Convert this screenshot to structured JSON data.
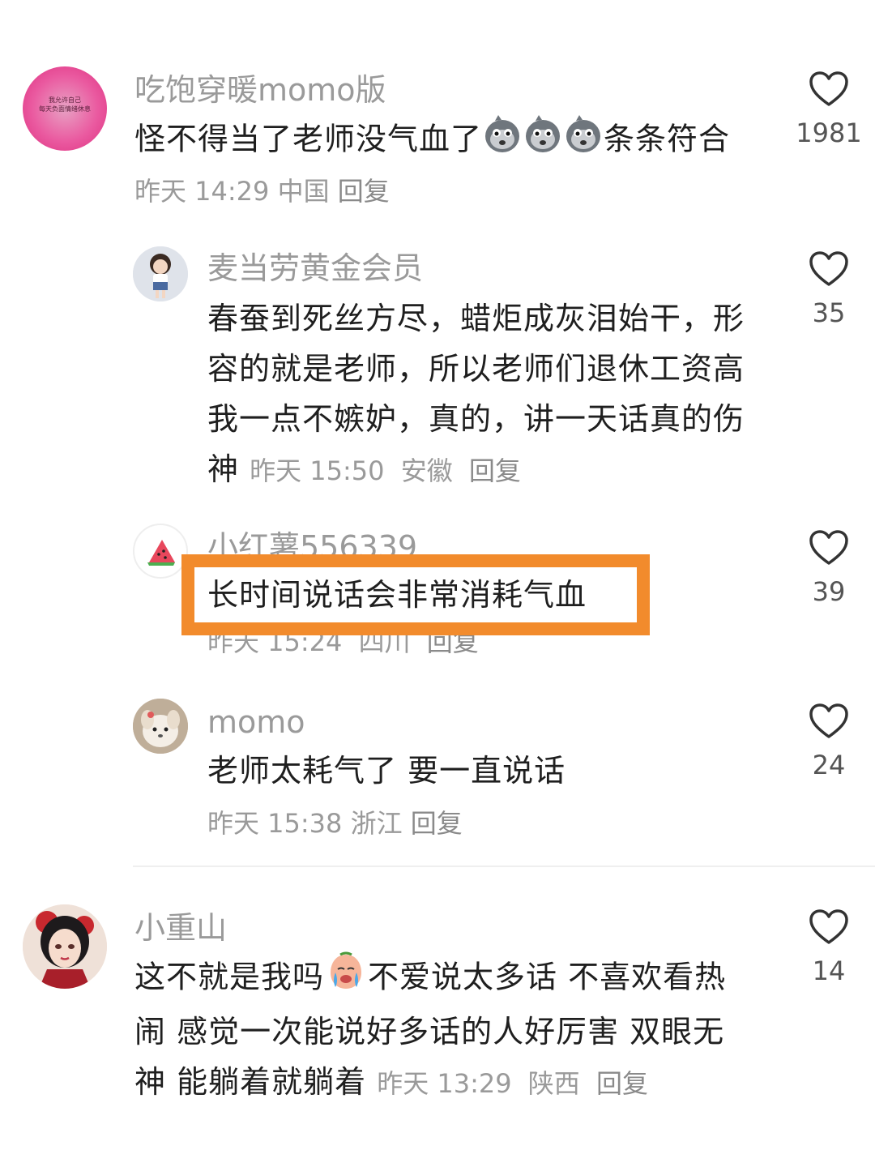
{
  "comments": [
    {
      "name": "吃饱穿暖momo版",
      "text_before": "怪不得当了老师没气血了",
      "text_after": "条条符合",
      "emojis": [
        "sad-face-emoji",
        "sad-face-emoji",
        "sad-face-emoji"
      ],
      "time": "昨天 14:29",
      "location": "中国",
      "reply": "回复",
      "likes": "1981",
      "avatar_text": "我允许自己\n每天负面情绪休息"
    },
    {
      "name": "麦当劳黄金会员",
      "text": "春蚕到死丝方尽，蜡炬成灰泪始干，形容的就是老师，所以老师们退休工资高我一点不嫉妒，真的，讲一天话真的伤神",
      "time": "昨天 15:50",
      "location": "安徽",
      "reply": "回复",
      "likes": "35"
    },
    {
      "name": "小红薯556339",
      "text": "长时间说话会非常消耗气血",
      "time": "昨天 15:24",
      "location": "四川",
      "reply": "回复",
      "likes": "39"
    },
    {
      "name": "momo",
      "text": "老师太耗气了 要一直说话",
      "time": "昨天 15:38",
      "location": "浙江",
      "reply": "回复",
      "likes": "24"
    },
    {
      "name": "小重山",
      "text_before": "这不就是我吗",
      "text_after": "不爱说太多话 不喜欢看热闹 感觉一次能说好多话的人好厉害 双眼无神 能躺着就躺着",
      "emoji": "crying-face-emoji",
      "time": "昨天 13:29",
      "location": "陕西",
      "reply": "回复",
      "likes": "14"
    }
  ],
  "colors": {
    "highlight": "#f28b2c",
    "meta": "#9a9a9a",
    "text": "#1f1f1f"
  }
}
